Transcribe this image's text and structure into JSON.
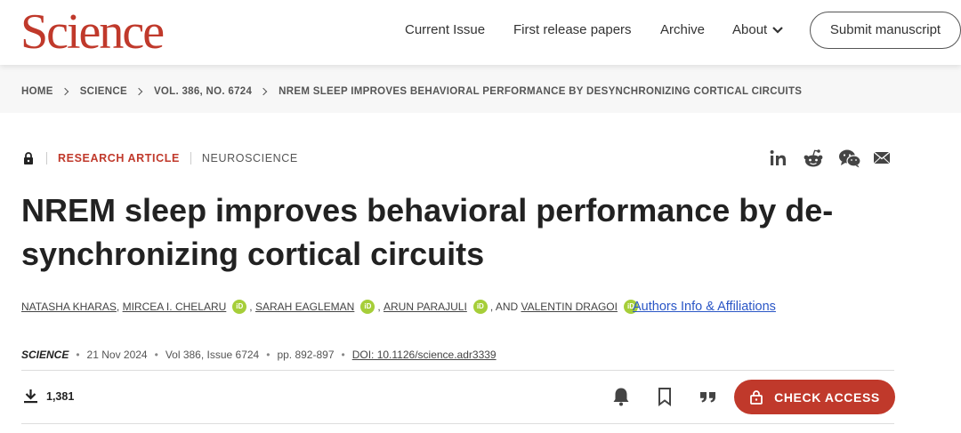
{
  "header": {
    "logo": "Science",
    "nav": {
      "current_issue": "Current Issue",
      "first_release": "First release papers",
      "archive": "Archive",
      "about": "About"
    },
    "submit_label": "Submit manuscript"
  },
  "breadcrumb": [
    "HOME",
    "SCIENCE",
    "VOL. 386, NO. 6724",
    "NREM SLEEP IMPROVES BEHAVIORAL PERFORMANCE BY DESYNCHRONIZING CORTICAL CIRCUITS"
  ],
  "article": {
    "type": "RESEARCH ARTICLE",
    "subject": "NEUROSCIENCE",
    "title_line1": "NREM sleep improves behavioral performance by de-",
    "title_line2": "synchronizing cortical circuits",
    "authors": [
      "NATASHA KHARAS",
      "MIRCEA I. CHELARU",
      "SARAH EAGLEMAN",
      "ARUN PARAJULI",
      "VALENTIN DRAGOI"
    ],
    "orcid_label": "iD",
    "and_label": ", AND",
    "affiliations_link": "Authors Info & Affiliations",
    "journal": "SCIENCE",
    "date": "21 Nov 2024",
    "volume": "Vol 386, Issue 6724",
    "pages": "pp. 892-897",
    "doi": "DOI: 10.1126/science.adr3339",
    "downloads": "1,381",
    "check_access": "CHECK ACCESS"
  },
  "share_icons": [
    "linkedin-icon",
    "reddit-icon",
    "wechat-icon",
    "email-icon"
  ],
  "colors": {
    "brand_red": "#c0392b",
    "link_blue": "#2a56c6",
    "orcid_green": "#a6ce39"
  }
}
